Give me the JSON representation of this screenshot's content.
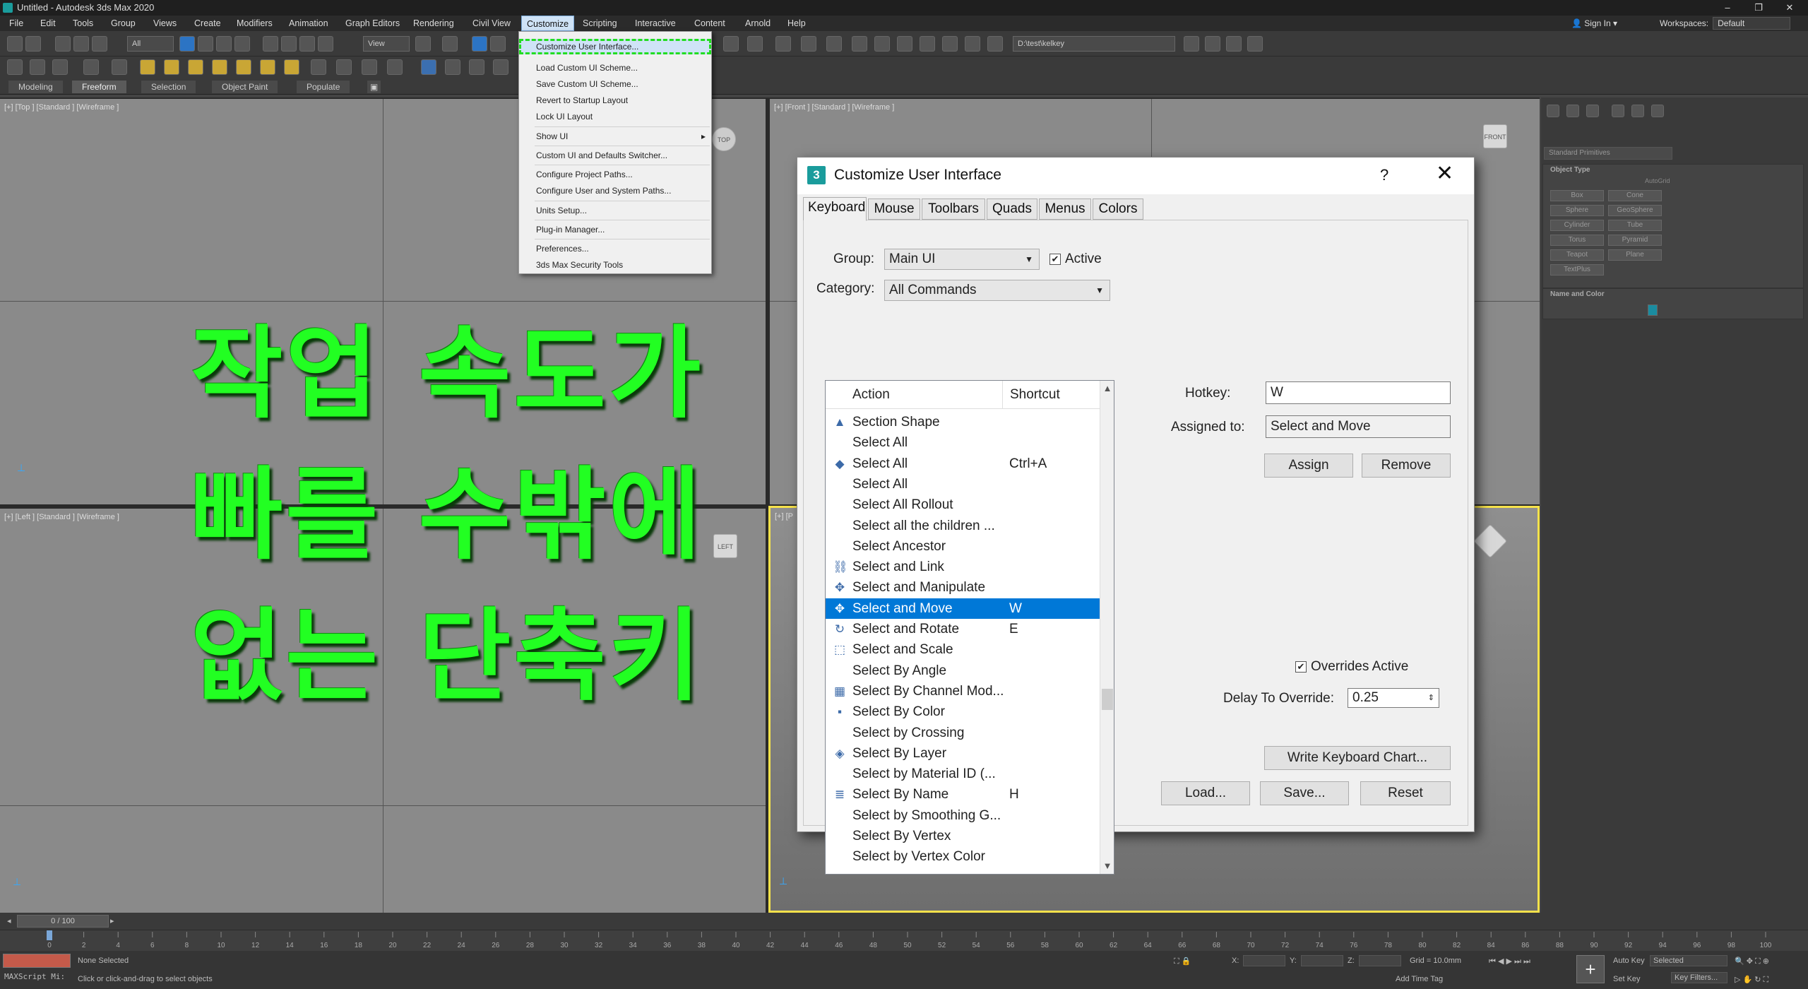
{
  "window": {
    "title": "Untitled - Autodesk 3ds Max 2020",
    "minimize": "–",
    "restore": "❐",
    "close": "✕"
  },
  "menubar": {
    "items": [
      "File",
      "Edit",
      "Tools",
      "Group",
      "Views",
      "Create",
      "Modifiers",
      "Animation",
      "Graph Editors",
      "Rendering",
      "Civil View",
      "Customize",
      "Scripting",
      "Interactive",
      "Content",
      "Arnold",
      "Help"
    ],
    "active": "Customize",
    "sign_in": "Sign In",
    "workspaces_label": "Workspaces:",
    "workspaces_value": "Default"
  },
  "toolbar": {
    "selection_filter": "All",
    "ref_coord": "View",
    "project_path": "D:\\test\\kelkey"
  },
  "ribbon": {
    "tabs": [
      "Modeling",
      "Freeform",
      "Selection",
      "Object Paint",
      "Populate"
    ],
    "active": "Freeform"
  },
  "viewports": {
    "top_label": "[+] [Top ] [Standard ] [Wireframe ]",
    "front_label": "[+] [Front ] [Standard ] [Wireframe ]",
    "left_label": "[+] [Left ] [Standard ] [Wireframe ]",
    "persp_label": "[+] [P",
    "cube_top": "TOP",
    "cube_front": "FRONT",
    "cube_left": "LEFT"
  },
  "overlay": {
    "lines": [
      "작업 속도가",
      "빠를 수밖에",
      "없는 단축키"
    ],
    "color": "#22ff22"
  },
  "customize_menu": {
    "items": [
      {
        "label": "Customize User Interface...",
        "selected": true
      },
      {
        "label": "Load Custom UI Scheme..."
      },
      {
        "label": "Save Custom UI Scheme..."
      },
      {
        "label": "Revert to Startup Layout"
      },
      {
        "label": "Lock UI Layout"
      },
      {
        "label": "Show UI",
        "submenu": "▸"
      },
      {
        "label": "Custom UI and Defaults Switcher..."
      },
      {
        "label": "Configure Project Paths..."
      },
      {
        "label": "Configure User and System Paths..."
      },
      {
        "label": "Units Setup..."
      },
      {
        "label": "Plug-in Manager..."
      },
      {
        "label": "Preferences..."
      },
      {
        "label": "3ds Max Security Tools"
      }
    ]
  },
  "command_panel": {
    "dropdown": "Standard Primitives",
    "object_type": "Object Type",
    "autogrid": "AutoGrid",
    "buttons": [
      "Box",
      "Cone",
      "Sphere",
      "GeoSphere",
      "Cylinder",
      "Tube",
      "Torus",
      "Pyramid",
      "Teapot",
      "Plane",
      "TextPlus"
    ],
    "name_and_color": "Name and Color",
    "swatch_color": "#1a8ca0"
  },
  "timeline": {
    "frame": "0 / 100"
  },
  "ruler": {
    "ticks": [
      "0",
      "2",
      "4",
      "6",
      "8",
      "10",
      "12",
      "14",
      "16",
      "18",
      "20",
      "22",
      "24",
      "26",
      "28",
      "30",
      "32",
      "34",
      "36",
      "38",
      "40",
      "42",
      "44",
      "46",
      "48",
      "50",
      "52",
      "54",
      "56",
      "58",
      "60",
      "62",
      "64",
      "66",
      "68",
      "70",
      "72",
      "74",
      "76",
      "78",
      "80",
      "82",
      "84",
      "86",
      "88",
      "90",
      "92",
      "94",
      "96",
      "98",
      "100"
    ]
  },
  "status": {
    "maxscript": "MAXScript Mi:",
    "none_selected": "None Selected",
    "hint": "Click or click-and-drag to select objects",
    "x_label": "X:",
    "y_label": "Y:",
    "z_label": "Z:",
    "grid": "Grid = 10.0mm",
    "add_time_tag": "Add Time Tag",
    "auto_key": "Auto Key",
    "set_key": "Set Key",
    "selected": "Selected",
    "key_filters": "Key Filters..."
  },
  "dialog": {
    "title": "Customize User Interface",
    "icon": "3",
    "help": "?",
    "close": "✕",
    "tabs": [
      "Keyboard",
      "Mouse",
      "Toolbars",
      "Quads",
      "Menus",
      "Colors"
    ],
    "active_tab": "Keyboard",
    "group_label": "Group:",
    "group_value": "Main UI",
    "active_label": "Active",
    "category_label": "Category:",
    "category_value": "All Commands",
    "col_action": "Action",
    "col_shortcut": "Shortcut",
    "actions": [
      {
        "icon": "▲",
        "action": "Section Shape",
        "shortcut": ""
      },
      {
        "icon": "",
        "action": "Select All",
        "shortcut": ""
      },
      {
        "icon": "◆",
        "action": "Select All",
        "shortcut": "Ctrl+A"
      },
      {
        "icon": "",
        "action": "Select All",
        "shortcut": ""
      },
      {
        "icon": "",
        "action": "Select All Rollout",
        "shortcut": ""
      },
      {
        "icon": "",
        "action": "Select all the children ...",
        "shortcut": ""
      },
      {
        "icon": "",
        "action": "Select Ancestor",
        "shortcut": ""
      },
      {
        "icon": "⛓",
        "action": "Select and Link",
        "shortcut": ""
      },
      {
        "icon": "✥",
        "action": "Select and Manipulate",
        "shortcut": ""
      },
      {
        "icon": "✥",
        "action": "Select and Move",
        "shortcut": "W",
        "selected": true
      },
      {
        "icon": "↻",
        "action": "Select and Rotate",
        "shortcut": "E"
      },
      {
        "icon": "⬚",
        "action": "Select and Scale",
        "shortcut": ""
      },
      {
        "icon": "",
        "action": "Select By Angle",
        "shortcut": ""
      },
      {
        "icon": "▦",
        "action": "Select By Channel Mod...",
        "shortcut": ""
      },
      {
        "icon": "▪",
        "action": "Select By Color",
        "shortcut": ""
      },
      {
        "icon": "",
        "action": "Select by Crossing",
        "shortcut": ""
      },
      {
        "icon": "◈",
        "action": "Select By Layer",
        "shortcut": ""
      },
      {
        "icon": "",
        "action": "Select by Material ID (...",
        "shortcut": ""
      },
      {
        "icon": "≣",
        "action": "Select By Name",
        "shortcut": "H"
      },
      {
        "icon": "",
        "action": "Select by Smoothing G...",
        "shortcut": ""
      },
      {
        "icon": "",
        "action": "Select By Vertex",
        "shortcut": ""
      },
      {
        "icon": "",
        "action": "Select by Vertex Color",
        "shortcut": ""
      }
    ],
    "hotkey_label": "Hotkey:",
    "hotkey_value": "W",
    "assigned_label": "Assigned to:",
    "assigned_value": "Select and Move",
    "assign_btn": "Assign",
    "remove_btn": "Remove",
    "overrides_label": "Overrides Active",
    "delay_label": "Delay To Override:",
    "delay_value": "0.25",
    "write_chart_btn": "Write Keyboard Chart...",
    "load_btn": "Load...",
    "save_btn": "Save...",
    "reset_btn": "Reset"
  }
}
